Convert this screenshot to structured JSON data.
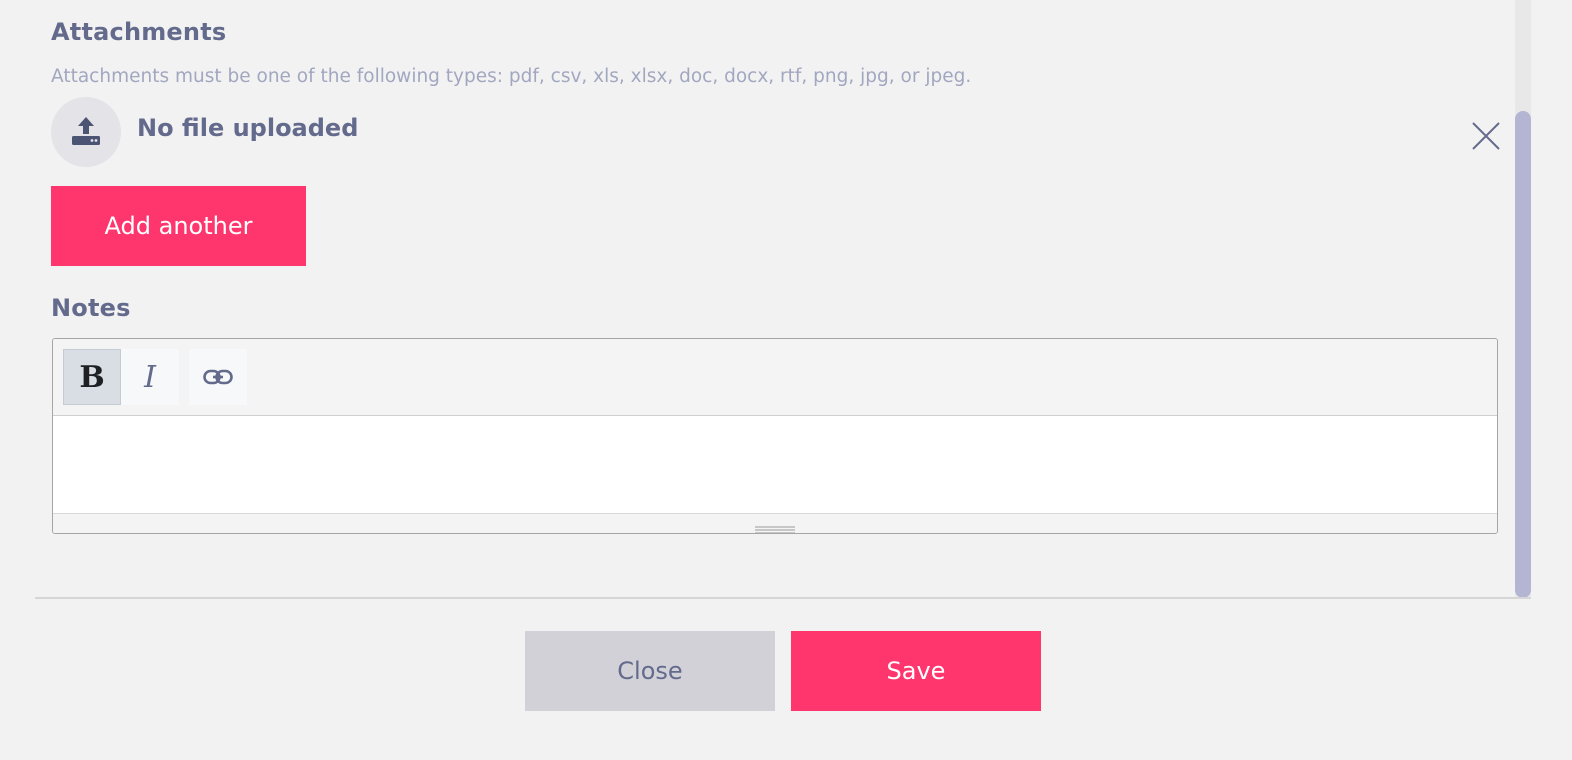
{
  "attachments": {
    "title": "Attachments",
    "help_text": "Attachments must be one of the following types: pdf, csv, xls, xlsx, doc, docx, rtf, png, jpg, or jpeg.",
    "file_status": "No file uploaded",
    "upload_icon": "upload-icon",
    "remove_icon": "close-icon",
    "add_another_label": "Add another"
  },
  "notes": {
    "title": "Notes",
    "toolbar": {
      "bold_label": "B",
      "italic_label": "I",
      "link_icon": "link-icon"
    },
    "content": ""
  },
  "footer": {
    "close_label": "Close",
    "save_label": "Save"
  },
  "colors": {
    "accent": "#ff366e",
    "heading": "#636a8c",
    "muted_text": "#a2a7c0",
    "background": "#f2f2f2",
    "scrollbar_thumb": "#b3b5d2",
    "secondary_button": "#d2d1d8"
  }
}
